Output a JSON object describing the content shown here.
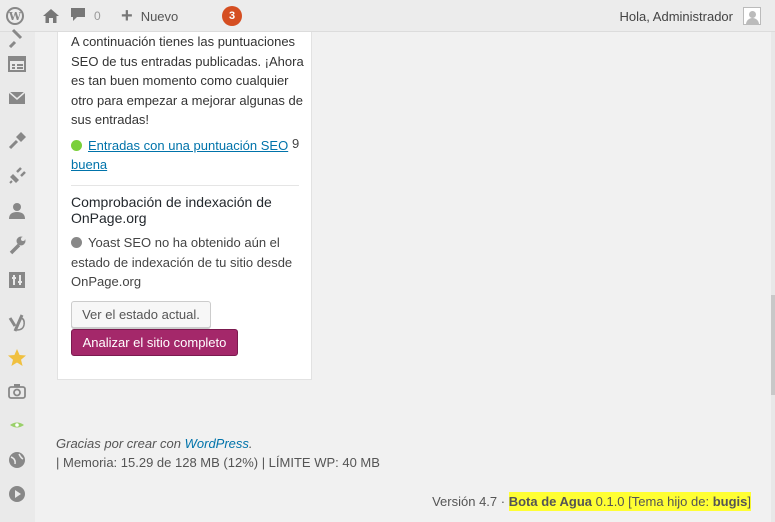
{
  "adminbar": {
    "comments_count": "0",
    "new_label": "Nuevo",
    "updates_count": "3",
    "greeting": "Hola, Administrador"
  },
  "widget": {
    "intro": "A continuación tienes las puntuaciones SEO de tus entradas publicadas. ¡Ahora es tan buen momento como cualquier otro para empezar a mejorar algunas de sus entradas!",
    "good_link": "Entradas con una puntuación SEO buena",
    "good_count": "9",
    "indexing_title": "Comprobación de indexación de OnPage.org",
    "indexing_text": "Yoast SEO no ha obtenido aún el estado de indexación de tu sitio desde OnPage.org",
    "view_status_button": "Ver el estado actual.",
    "analyze_button": "Analizar el sitio completo"
  },
  "footer": {
    "thanks_prefix": "Gracias por crear con ",
    "thanks_link": "WordPress",
    "thanks_suffix": ".",
    "memory": "| Memoria: 15.29 de 128 MB (12%) | LÍMITE WP: 40 MB",
    "version": "Versión 4.7 · ",
    "theme_name": "Bota de Agua",
    "theme_version": " 0.1.0 [Tema hijo de: ",
    "parent_theme": "bugis",
    "close_bracket": "]"
  },
  "colors": {
    "accent_yoast": "#a4286a",
    "seo_good": "#7ad03a",
    "update_badge": "#d54e21",
    "highlight": "#ffff33"
  },
  "icons": {
    "sidebar": [
      "pin-icon",
      "pages-icon",
      "mail-icon",
      "appearance-icon",
      "plugins-icon",
      "users-icon",
      "tools-icon",
      "settings-icon",
      "yoast-icon",
      "star-icon",
      "camera-icon",
      "eye-icon",
      "globe-icon",
      "play-icon"
    ]
  }
}
